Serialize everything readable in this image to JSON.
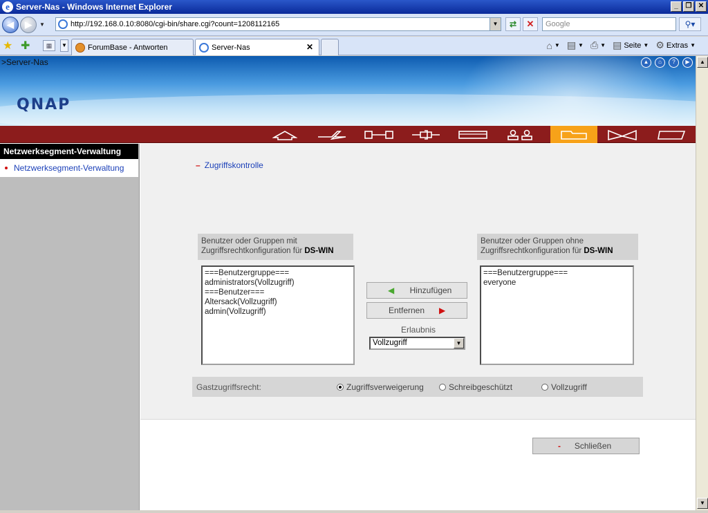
{
  "window": {
    "title": "Server-Nas - Windows Internet Explorer",
    "buttons": [
      "_",
      "❐",
      "✕"
    ]
  },
  "address": {
    "url": "http://192.168.0.10:8080/cgi-bin/share.cgi?count=1208112165",
    "search_placeholder": "Google"
  },
  "tabs": [
    {
      "label": "ForumBase - Antworten"
    },
    {
      "label": "Server-Nas",
      "close": "✕"
    }
  ],
  "commandbar": {
    "page_label": "Seite",
    "tools_label": "Extras"
  },
  "page": {
    "breadcrumb": ">Server-Nas",
    "logo": "QNAP"
  },
  "menu": {
    "icons": [
      "home-icon",
      "lightning-icon",
      "network-icon",
      "tools-icon",
      "disk-icon",
      "users-icon",
      "folder-icon",
      "bowtie-icon",
      "tag-icon"
    ],
    "active": "folder-icon"
  },
  "sidebar": {
    "title": "Netzwerksegment-Verwaltung",
    "items": [
      {
        "label": "Netzwerksegment-Verwaltung"
      }
    ]
  },
  "main": {
    "section_title": "Zugriffskontrolle",
    "left_box": {
      "label_line1": "Benutzer oder Gruppen mit",
      "label_line2": "Zugriffsrechtkonfiguration für",
      "share": "DS-WIN",
      "items": [
        "===Benutzergruppe===",
        "administrators(Vollzugriff)",
        "===Benutzer===",
        "Altersack(Vollzugriff)",
        "admin(Vollzugriff)"
      ]
    },
    "right_box": {
      "label_line1": "Benutzer oder Gruppen ohne",
      "label_line2": "Zugriffsrechtkonfiguration für",
      "share": "DS-WIN",
      "items": [
        "===Benutzergruppe===",
        "everyone"
      ]
    },
    "add_button": "Hinzufügen",
    "remove_button": "Entfernen",
    "permission_label": "Erlaubnis",
    "permission_value": "Vollzugriff",
    "guest": {
      "label": "Gastzugriffsrecht:",
      "options": [
        "Zugriffsverweigerung",
        "Schreibgeschützt",
        "Vollzugriff"
      ],
      "selected": "Zugriffsverweigerung"
    },
    "close_button": "Schließen"
  }
}
